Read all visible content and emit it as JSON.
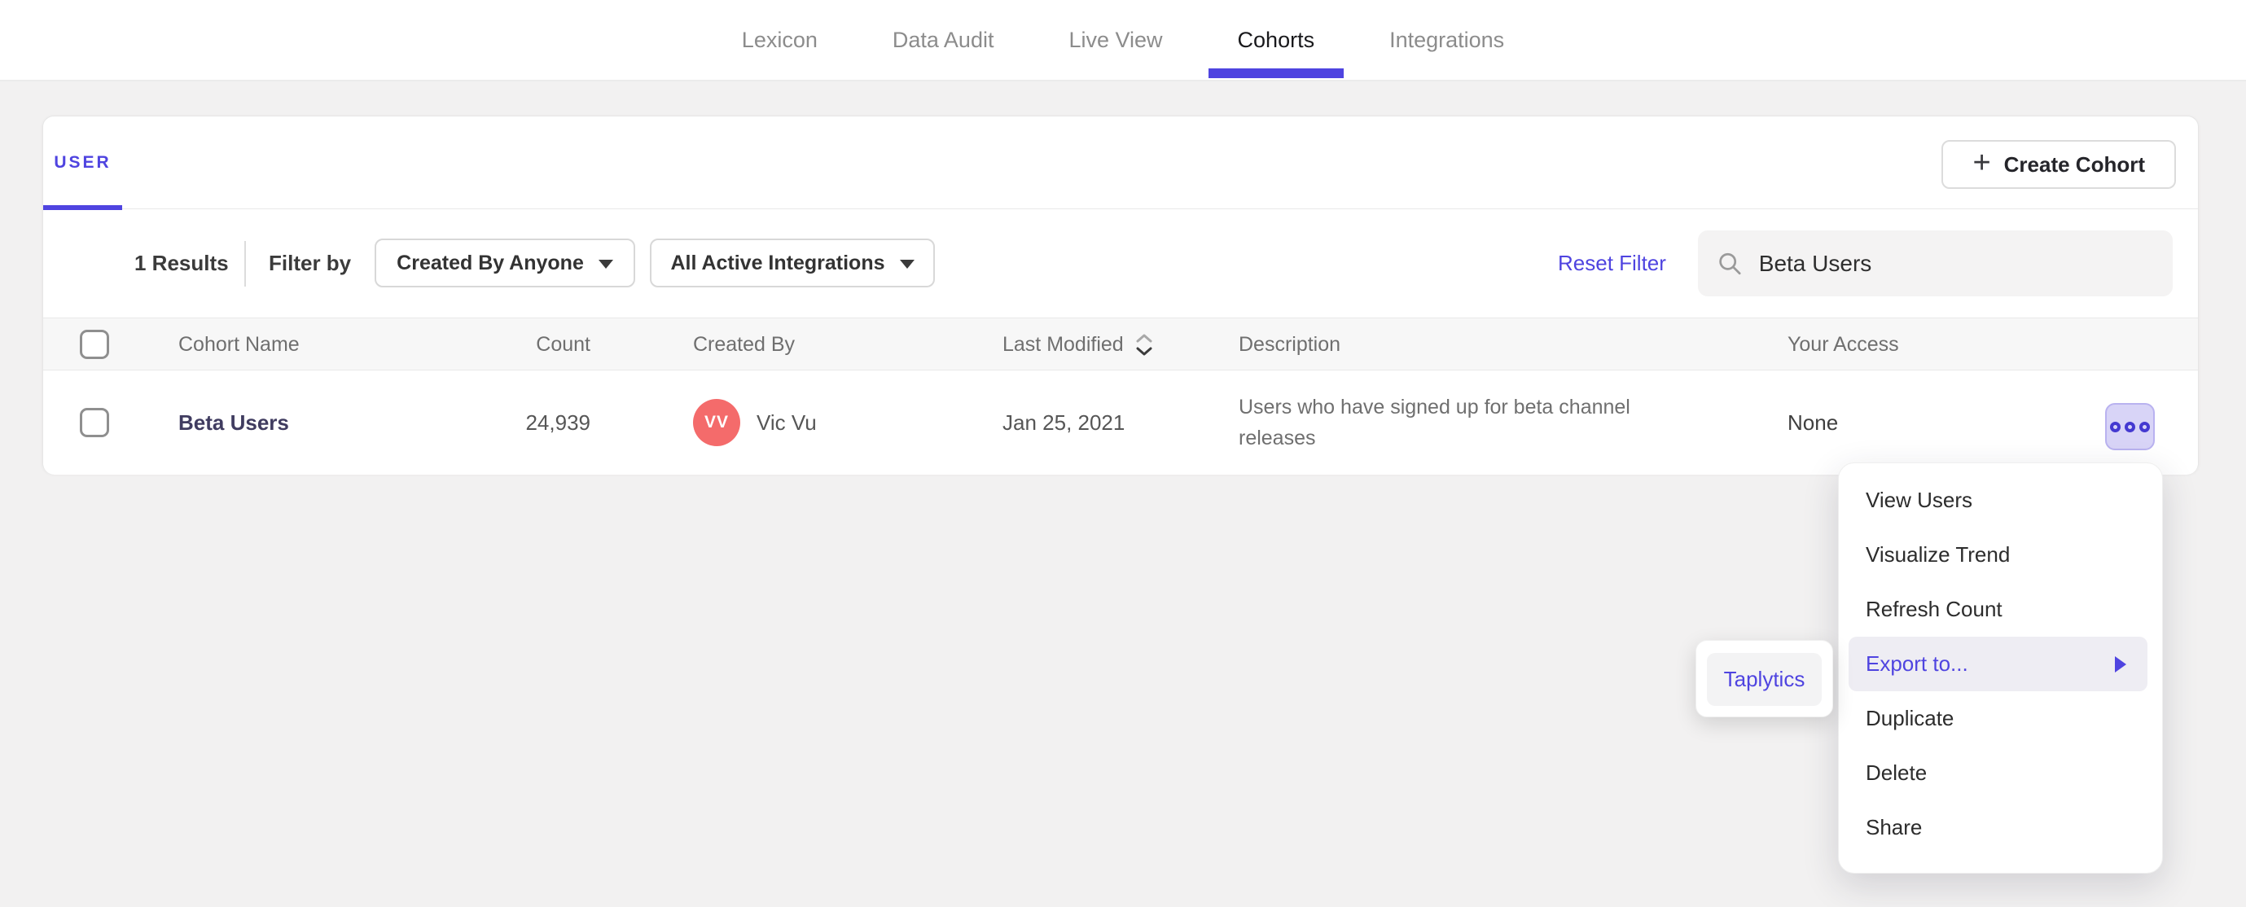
{
  "nav": {
    "items": [
      {
        "label": "Lexicon",
        "active": false
      },
      {
        "label": "Data Audit",
        "active": false
      },
      {
        "label": "Live View",
        "active": false
      },
      {
        "label": "Cohorts",
        "active": true
      },
      {
        "label": "Integrations",
        "active": false
      }
    ]
  },
  "cohorts": {
    "tab_label": "USER",
    "create_button_label": "Create Cohort",
    "toolbar": {
      "results": "1 Results",
      "filter_by": "Filter by",
      "created_by_filter": "Created By Anyone",
      "integrations_filter": "All Active Integrations",
      "reset_filter": "Reset Filter",
      "search_value": "Beta Users"
    },
    "table": {
      "headers": {
        "name": "Cohort Name",
        "count": "Count",
        "created_by": "Created By",
        "last_modified": "Last Modified",
        "description": "Description",
        "your_access": "Your Access"
      },
      "row": {
        "name": "Beta Users",
        "count": "24,939",
        "avatar_initials": "VV",
        "created_by": "Vic Vu",
        "last_modified": "Jan 25, 2021",
        "description": "Users who have signed up for beta channel releases",
        "your_access": "None"
      }
    }
  },
  "context_menu": {
    "items": [
      {
        "label": "View Users",
        "highlighted": false
      },
      {
        "label": "Visualize Trend",
        "highlighted": false
      },
      {
        "label": "Refresh Count",
        "highlighted": false
      },
      {
        "label": "Export to...",
        "highlighted": true,
        "has_submenu": true
      },
      {
        "label": "Duplicate",
        "highlighted": false
      },
      {
        "label": "Delete",
        "highlighted": false
      },
      {
        "label": "Share",
        "highlighted": false
      }
    ]
  },
  "export_submenu": {
    "items": [
      {
        "label": "Taplytics"
      }
    ]
  },
  "colors": {
    "accent": "#4f44e0",
    "avatar": "#f46b6b",
    "menu_button_bg": "#d8d4f7",
    "menu_button_dots": "#4439d1",
    "highlight_row_bg": "#eeedf3",
    "page_bg": "#f2f1f1",
    "nav_inactive": "#8c8c8c",
    "nav_active": "#19191c"
  }
}
